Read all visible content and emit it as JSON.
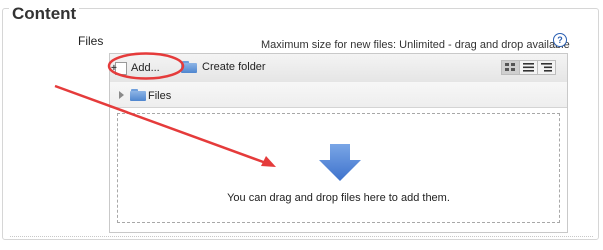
{
  "section": {
    "title": "Content"
  },
  "field": {
    "label": "Files"
  },
  "max_size_text": "Maximum size for new files: Unlimited - drag and drop available",
  "help": {
    "glyph": "?"
  },
  "toolbar": {
    "add_label": "Add...",
    "create_folder_label": "Create folder"
  },
  "path": {
    "label": "Files"
  },
  "dropzone": {
    "text": "You can drag and drop files here to add them."
  },
  "colors": {
    "annotation": "#e53b3b",
    "drop_arrow": "#4a7fd6",
    "folder": "#5b8fd6"
  }
}
